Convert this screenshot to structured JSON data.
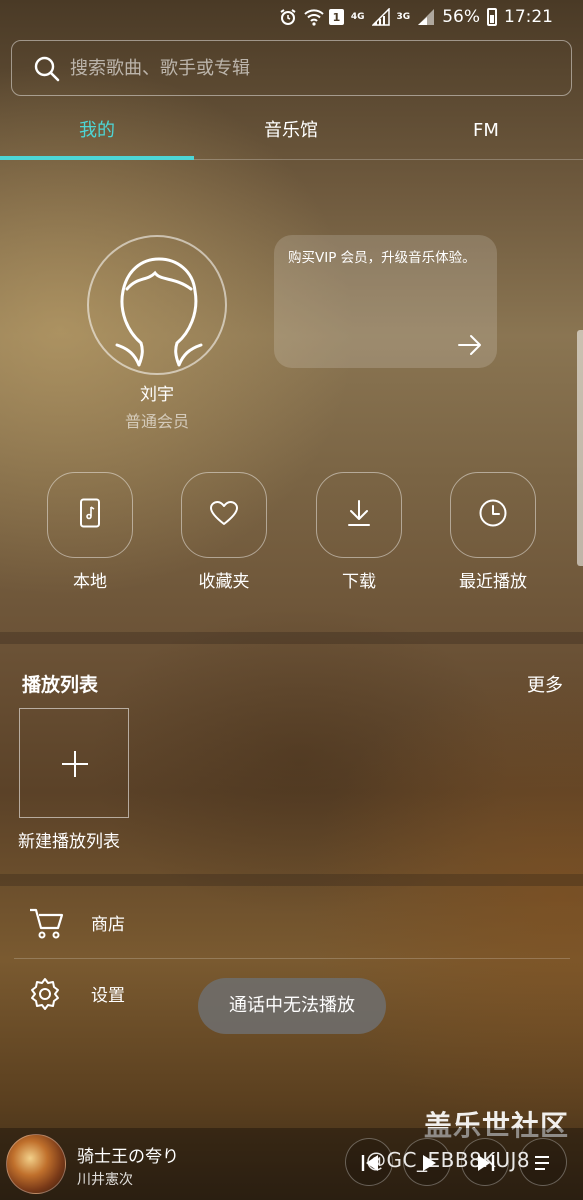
{
  "status_bar": {
    "net1": "4G",
    "net2": "3G",
    "sim_badge": "1",
    "battery": "56%",
    "time": "17:21"
  },
  "search": {
    "placeholder": "搜索歌曲、歌手或专辑"
  },
  "tabs": [
    {
      "label": "我的",
      "active": true
    },
    {
      "label": "音乐馆",
      "active": false
    },
    {
      "label": "FM",
      "active": false
    }
  ],
  "profile": {
    "name": "刘宇",
    "level": "普通会员"
  },
  "vip_card": {
    "text": "购买VIP 会员，升级音乐体验。"
  },
  "quick_actions": [
    {
      "label": "本地",
      "icon": "phone-music-icon"
    },
    {
      "label": "收藏夹",
      "icon": "heart-icon"
    },
    {
      "label": "下载",
      "icon": "download-icon"
    },
    {
      "label": "最近播放",
      "icon": "clock-icon"
    }
  ],
  "playlists": {
    "title": "播放列表",
    "more": "更多",
    "new_label": "新建播放列表"
  },
  "menu": [
    {
      "label": "商店",
      "icon": "cart-icon"
    },
    {
      "label": "设置",
      "icon": "gear-icon"
    }
  ],
  "toast": "通话中无法播放",
  "watermark": "盖乐世社区",
  "watermark_user": "@GC_EBB8KUJ8",
  "now_playing": {
    "title": "骑士王の夸り",
    "artist": "川井憲次"
  },
  "colors": {
    "accent": "#4dd6d6"
  }
}
